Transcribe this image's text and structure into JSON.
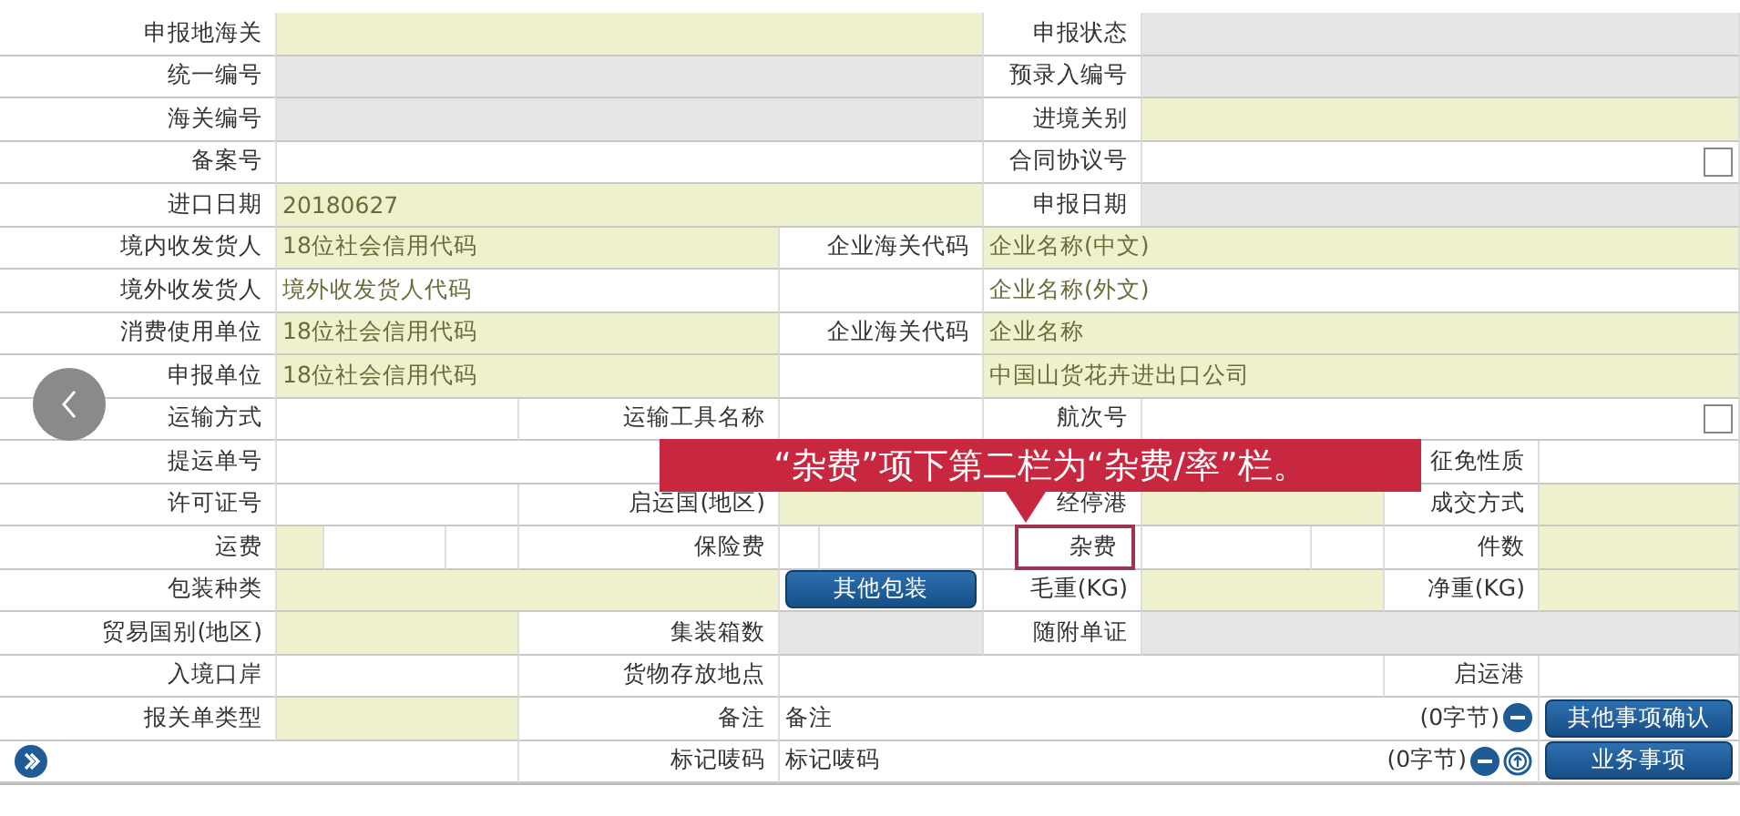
{
  "form": {
    "lines": [
      {
        "items": [
          {
            "kind": "label",
            "text": "申报地海关"
          },
          {
            "kind": "required_field"
          },
          {
            "kind": "label",
            "text": "申报状态"
          },
          {
            "kind": "readonly_field"
          }
        ]
      },
      {
        "items": [
          {
            "kind": "label",
            "text": "统一编号"
          },
          {
            "kind": "readonly_field"
          },
          {
            "kind": "label",
            "text": "预录入编号"
          },
          {
            "kind": "readonly_field"
          }
        ]
      },
      {
        "items": [
          {
            "kind": "label",
            "text": "海关编号"
          },
          {
            "kind": "readonly_field"
          },
          {
            "kind": "label",
            "text": "进境关别"
          },
          {
            "kind": "required_field"
          }
        ]
      },
      {
        "items": [
          {
            "kind": "label",
            "text": "备案号"
          },
          {
            "kind": "field"
          },
          {
            "kind": "label",
            "text": "合同协议号"
          },
          {
            "kind": "field",
            "checkbox": {
              "checked": false
            }
          }
        ]
      },
      {
        "items": [
          {
            "kind": "label",
            "text": "进口日期"
          },
          {
            "kind": "required_field",
            "text": "20180627"
          },
          {
            "kind": "label",
            "text": "申报日期"
          },
          {
            "kind": "readonly_field"
          }
        ]
      },
      {
        "items": [
          {
            "kind": "label",
            "text": "境内收发货人"
          },
          {
            "kind": "required_field",
            "text": "18位社会信用代码"
          },
          {
            "kind": "label",
            "text": "企业海关代码"
          },
          {
            "kind": "required_field",
            "text": "企业名称(中文)"
          }
        ]
      },
      {
        "items": [
          {
            "kind": "label",
            "text": "境外收发货人"
          },
          {
            "kind": "field",
            "text": "境外收发货人代码"
          },
          {
            "kind": "field"
          },
          {
            "kind": "field",
            "text": "企业名称(外文)"
          }
        ]
      },
      {
        "items": [
          {
            "kind": "label",
            "text": "消费使用单位"
          },
          {
            "kind": "required_field",
            "text": "18位社会信用代码"
          },
          {
            "kind": "label",
            "text": "企业海关代码"
          },
          {
            "kind": "required_field",
            "text": "企业名称"
          }
        ]
      },
      {
        "items": [
          {
            "kind": "label",
            "text": "申报单位"
          },
          {
            "kind": "required_field",
            "text": "18位社会信用代码"
          },
          {
            "kind": "field"
          },
          {
            "kind": "required_field",
            "text": "中国山货花卉进出口公司"
          }
        ]
      },
      {
        "items": [
          {
            "kind": "label",
            "text": "运输方式"
          },
          {
            "kind": "field"
          },
          {
            "kind": "label",
            "text": "运输工具名称"
          },
          {
            "kind": "field"
          },
          {
            "kind": "label",
            "text": "航次号"
          },
          {
            "kind": "field",
            "checkbox": {
              "checked": false
            }
          }
        ]
      },
      {
        "items": [
          {
            "kind": "label",
            "text": "提运单号"
          },
          {
            "kind": "field"
          },
          {
            "kind": "label",
            "text": "征免性质"
          },
          {
            "kind": "field"
          }
        ]
      },
      {
        "items": [
          {
            "kind": "label",
            "text": "许可证号"
          },
          {
            "kind": "field"
          },
          {
            "kind": "label",
            "text": "启运国(地区)"
          },
          {
            "kind": "required_field"
          },
          {
            "kind": "label",
            "text": "经停港"
          },
          {
            "kind": "required_field"
          },
          {
            "kind": "label",
            "text": "成交方式"
          },
          {
            "kind": "required_field"
          }
        ]
      },
      {
        "items": [
          {
            "kind": "label",
            "text": "运费"
          },
          {
            "kind": "required_field"
          },
          {
            "kind": "field"
          },
          {
            "kind": "field"
          },
          {
            "kind": "label",
            "text": "保险费"
          },
          {
            "kind": "field"
          },
          {
            "kind": "field"
          },
          {
            "kind": "label",
            "text": "杂费",
            "highlighted": true
          },
          {
            "kind": "field"
          },
          {
            "kind": "field"
          },
          {
            "kind": "label",
            "text": "件数"
          },
          {
            "kind": "required_field"
          }
        ]
      },
      {
        "items": [
          {
            "kind": "label",
            "text": "包装种类"
          },
          {
            "kind": "required_field"
          },
          {
            "kind": "button",
            "text": "其他包装"
          },
          {
            "kind": "label",
            "text": "毛重(KG)"
          },
          {
            "kind": "required_field"
          },
          {
            "kind": "label",
            "text": "净重(KG)"
          },
          {
            "kind": "required_field"
          }
        ]
      },
      {
        "items": [
          {
            "kind": "label",
            "text": "贸易国别(地区)"
          },
          {
            "kind": "required_field"
          },
          {
            "kind": "label",
            "text": "集装箱数"
          },
          {
            "kind": "readonly_field"
          },
          {
            "kind": "label",
            "text": "随附单证"
          },
          {
            "kind": "readonly_field"
          }
        ]
      },
      {
        "items": [
          {
            "kind": "label",
            "text": "入境口岸"
          },
          {
            "kind": "field"
          },
          {
            "kind": "label",
            "text": "货物存放地点"
          },
          {
            "kind": "field"
          },
          {
            "kind": "label",
            "text": "启运港"
          },
          {
            "kind": "field"
          }
        ]
      },
      {
        "items": [
          {
            "kind": "label",
            "text": "报关单类型"
          },
          {
            "kind": "required_field"
          },
          {
            "kind": "label",
            "text": "备注"
          },
          {
            "kind": "note",
            "text": "备注",
            "count": "(0字节)",
            "detail_button": false
          },
          {
            "kind": "button",
            "text": "其他事项确认"
          }
        ]
      },
      {
        "items": [
          {
            "kind": "expand"
          },
          {
            "kind": "label",
            "text": "标记唛码"
          },
          {
            "kind": "note",
            "text": "标记唛码",
            "count": "(0字节)",
            "detail_button": true
          },
          {
            "kind": "button",
            "text": "业务事项"
          }
        ]
      }
    ]
  },
  "callout": {
    "text": "“杂费”项下第二栏为“杂费/率”栏。"
  }
}
